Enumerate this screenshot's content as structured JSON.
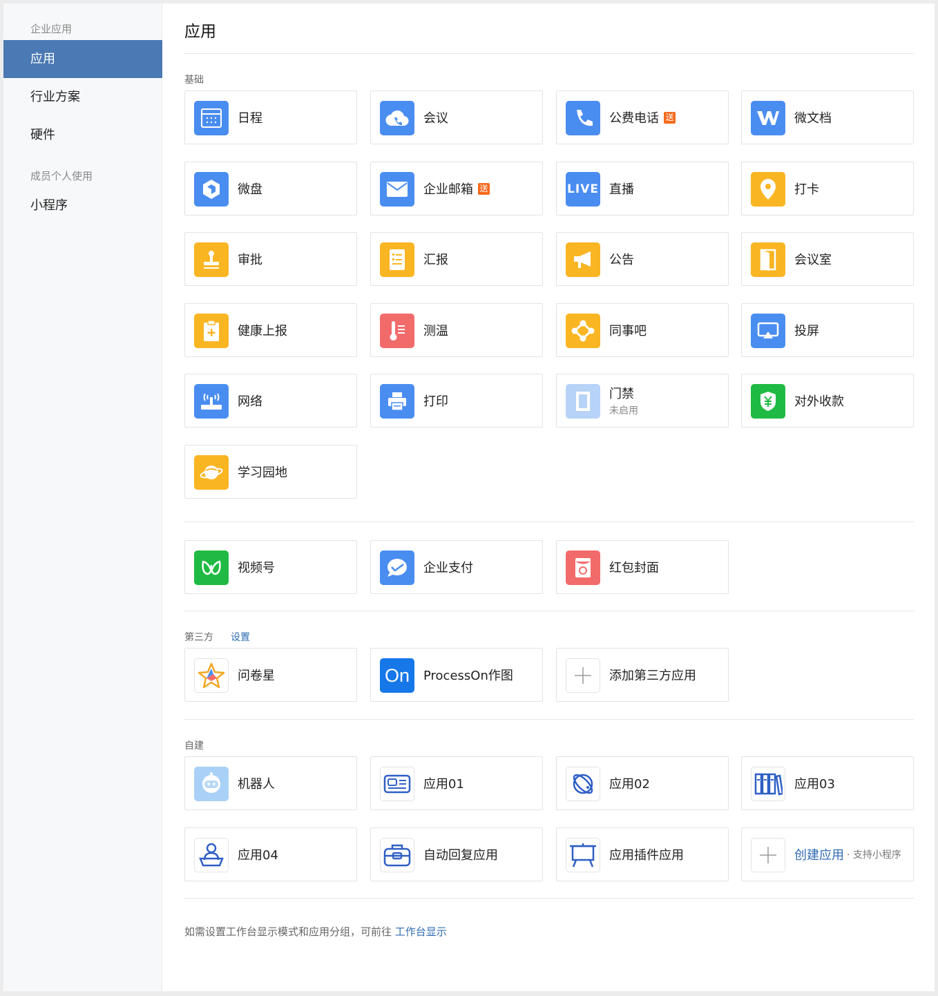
{
  "sidebar": {
    "group1": "企业应用",
    "items": [
      {
        "label": "应用"
      },
      {
        "label": "行业方案"
      },
      {
        "label": "硬件"
      }
    ],
    "group2": "成员个人使用",
    "items2": [
      {
        "label": "小程序"
      }
    ]
  },
  "main": {
    "title": "应用",
    "basic": {
      "label": "基础",
      "apps": [
        {
          "name": "日程",
          "icon": "calendar-icon"
        },
        {
          "name": "会议",
          "icon": "cloud-phone-icon"
        },
        {
          "name": "公费电话",
          "icon": "phone-icon",
          "tag": "送"
        },
        {
          "name": "微文档",
          "icon": "w-doc-icon"
        },
        {
          "name": "微盘",
          "icon": "cube-icon"
        },
        {
          "name": "企业邮箱",
          "icon": "mail-icon",
          "tag": "送"
        },
        {
          "name": "直播",
          "icon": "live-icon",
          "icon_text": "LIVE"
        },
        {
          "name": "打卡",
          "icon": "location-pin-icon"
        },
        {
          "name": "审批",
          "icon": "stamp-icon"
        },
        {
          "name": "汇报",
          "icon": "report-doc-icon"
        },
        {
          "name": "公告",
          "icon": "megaphone-icon"
        },
        {
          "name": "会议室",
          "icon": "door-icon"
        },
        {
          "name": "健康上报",
          "icon": "clipboard-plus-icon"
        },
        {
          "name": "测温",
          "icon": "thermometer-icon"
        },
        {
          "name": "同事吧",
          "icon": "network-nodes-icon"
        },
        {
          "name": "投屏",
          "icon": "screen-cast-icon"
        },
        {
          "name": "网络",
          "icon": "wifi-router-icon"
        },
        {
          "name": "打印",
          "icon": "printer-icon"
        },
        {
          "name": "门禁",
          "icon": "access-door-icon",
          "sub": "未启用"
        },
        {
          "name": "对外收款",
          "icon": "yuan-shield-icon"
        },
        {
          "name": "学习园地",
          "icon": "planet-icon"
        }
      ],
      "extras": [
        {
          "name": "视频号",
          "icon": "channels-icon"
        },
        {
          "name": "企业支付",
          "icon": "payment-bubble-icon"
        },
        {
          "name": "红包封面",
          "icon": "red-envelope-icon"
        }
      ]
    },
    "third_party": {
      "label": "第三方",
      "settings_link": "设置",
      "apps": [
        {
          "name": "问卷星",
          "icon": "star-icon"
        },
        {
          "name": "ProcessOn作图",
          "icon": "processon-icon",
          "icon_text": "On"
        },
        {
          "name": "添加第三方应用",
          "icon": "plus-icon"
        }
      ]
    },
    "custom": {
      "label": "自建",
      "apps": [
        {
          "name": "机器人",
          "icon": "robot-icon"
        },
        {
          "name": "应用01",
          "icon": "id-card-icon"
        },
        {
          "name": "应用02",
          "icon": "satellite-icon"
        },
        {
          "name": "应用03",
          "icon": "books-icon"
        },
        {
          "name": "应用04",
          "icon": "person-desk-icon"
        },
        {
          "name": "自动回复应用",
          "icon": "briefcase-icon"
        },
        {
          "name": "应用插件应用",
          "icon": "presentation-board-icon"
        },
        {
          "name": "创建应用",
          "icon": "plus-icon",
          "sub": "· 支持小程序"
        }
      ]
    },
    "footer": {
      "text": "如需设置工作台显示模式和应用分组，可前往",
      "link": "工作台显示"
    }
  },
  "colors": {
    "blue": "#4a8df0",
    "yellow": "#f9b522",
    "red": "#f26b6b",
    "green": "#1fba43",
    "sidebar_active": "#4a79b3",
    "link": "#2f6bb3",
    "tag": "#f5691c"
  }
}
